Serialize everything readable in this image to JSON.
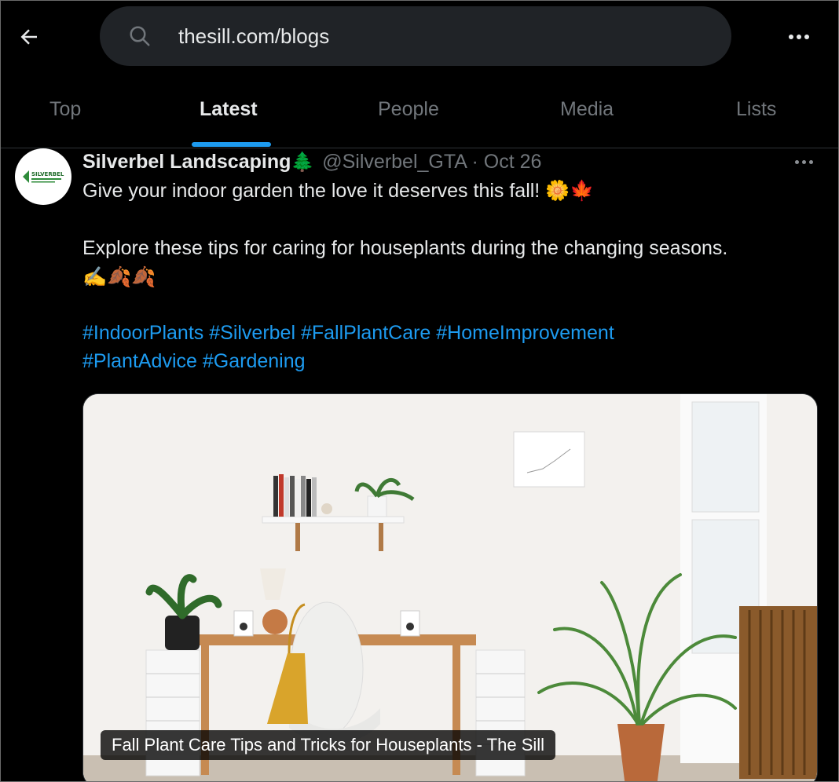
{
  "header": {
    "search_value": "thesill.com/blogs"
  },
  "tabs": [
    {
      "label": "Top",
      "active": false
    },
    {
      "label": "Latest",
      "active": true
    },
    {
      "label": "People",
      "active": false
    },
    {
      "label": "Media",
      "active": false
    },
    {
      "label": "Lists",
      "active": false
    }
  ],
  "tweet": {
    "display_name": "Silverbel Landscaping",
    "display_name_emoji": "🌲",
    "handle_and_date": "@Silverbel_GTA · Oct 26",
    "avatar_logo_text": "SILVERBEL",
    "line1": "Give your indoor garden the love it deserves this fall! 🌼🍁",
    "line2": "Explore these tips for caring for houseplants during the changing seasons.",
    "line3": "✍️🍂🍂",
    "hashtags_line1": [
      "#IndoorPlants",
      "#Silverbel",
      "#FallPlantCare",
      "#HomeImprovement"
    ],
    "hashtags_line2": [
      "#PlantAdvice",
      "#Gardening"
    ]
  },
  "card": {
    "title": "Fall Plant Care Tips and Tricks for Houseplants - The Sill"
  },
  "colors": {
    "accent": "#1d9bf0",
    "background": "#000000",
    "muted": "#71767b"
  }
}
